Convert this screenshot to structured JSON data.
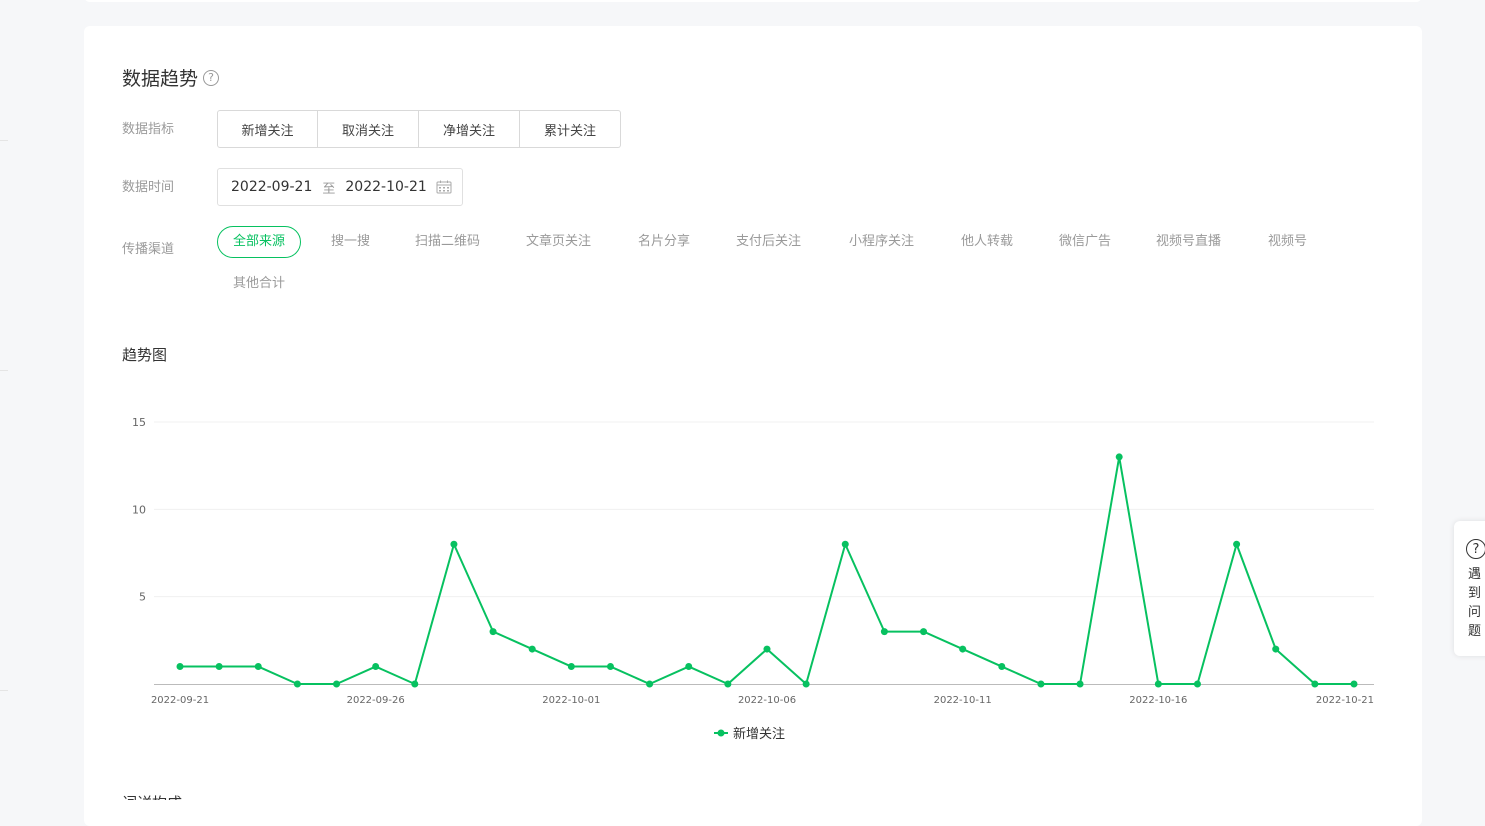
{
  "section": {
    "title": "数据趋势",
    "help_icon": "question-circle-icon",
    "metric_label": "数据指标",
    "metrics": [
      "新增关注",
      "取消关注",
      "净增关注",
      "累计关注"
    ],
    "active_metric_index": 0,
    "time_label": "数据时间",
    "date_start": "2022-09-21",
    "date_sep": "至",
    "date_end": "2022-10-21",
    "calendar_icon": "calendar-icon",
    "channel_label": "传播渠道",
    "channels": [
      "全部来源",
      "搜一搜",
      "扫描二维码",
      "文章页关注",
      "名片分享",
      "支付后关注",
      "小程序关注",
      "他人转载",
      "微信广告",
      "视频号直播",
      "视频号",
      "其他合计"
    ],
    "active_channel_index": 0,
    "chart_title": "趋势图",
    "next_section_title": "词详构成"
  },
  "help_float": {
    "icon": "question-circle-icon",
    "text": "遇到问题"
  },
  "colors": {
    "accent": "#07c160",
    "muted": "#9a9a9a",
    "grid": "#f0f0f0"
  },
  "chart_data": {
    "type": "line",
    "title": "",
    "xlabel": "",
    "ylabel": "",
    "x": [
      "2022-09-21",
      "2022-09-22",
      "2022-09-23",
      "2022-09-24",
      "2022-09-25",
      "2022-09-26",
      "2022-09-27",
      "2022-09-28",
      "2022-09-29",
      "2022-09-30",
      "2022-10-01",
      "2022-10-02",
      "2022-10-03",
      "2022-10-04",
      "2022-10-05",
      "2022-10-06",
      "2022-10-07",
      "2022-10-08",
      "2022-10-09",
      "2022-10-10",
      "2022-10-11",
      "2022-10-12",
      "2022-10-13",
      "2022-10-14",
      "2022-10-15",
      "2022-10-16",
      "2022-10-17",
      "2022-10-18",
      "2022-10-19",
      "2022-10-20",
      "2022-10-21"
    ],
    "x_ticks": [
      "2022-09-21",
      "2022-09-26",
      "2022-10-01",
      "2022-10-06",
      "2022-10-11",
      "2022-10-16",
      "2022-10-21"
    ],
    "y_ticks": [
      5,
      10,
      15
    ],
    "ylim": [
      0,
      15
    ],
    "grid": true,
    "legend_position": "bottom-center",
    "series": [
      {
        "name": "新增关注",
        "color": "#07c160",
        "values": [
          1,
          1,
          1,
          0,
          0,
          1,
          0,
          8,
          3,
          2,
          1,
          1,
          0,
          1,
          0,
          2,
          0,
          8,
          3,
          3,
          2,
          1,
          0,
          0,
          13,
          0,
          0,
          8,
          2,
          0,
          0
        ]
      }
    ]
  }
}
